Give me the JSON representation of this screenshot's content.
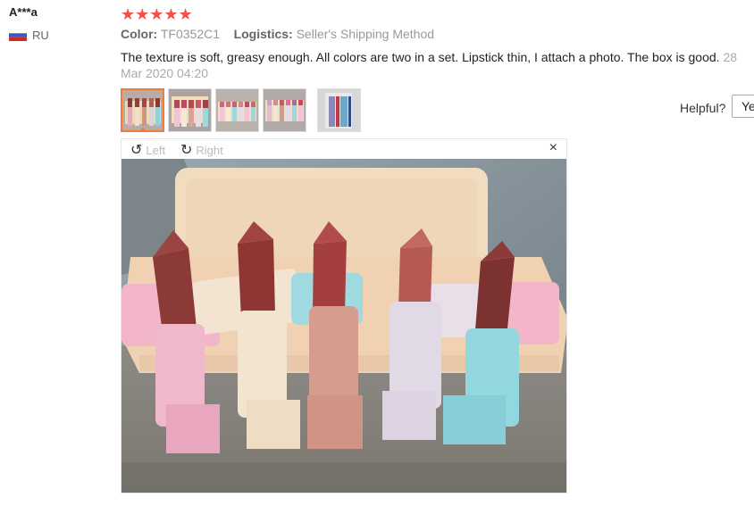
{
  "review": {
    "username": "A***a",
    "country": "RU",
    "stars": "★★★★★",
    "color_label": "Color:",
    "color_value": "TF0352C1",
    "logistics_label": "Logistics:",
    "logistics_value": "Seller's Shipping Method",
    "text": "The texture is soft, greasy enough. All colors are two in a set. Lipstick thin, I attach a photo. The box is good.",
    "date": "28 Mar 2020 04:20",
    "helpful_label": "Helpful?",
    "yes_label": "Ye"
  },
  "viewer": {
    "rotate_left": "Left",
    "rotate_right": "Right",
    "close": "×",
    "rotate_left_icon": "rotate-left-icon",
    "rotate_right_icon": "rotate-right-icon"
  },
  "thumbnails": [
    "thumb-1",
    "thumb-2",
    "thumb-3",
    "thumb-4",
    "thumb-5"
  ],
  "colors": {
    "stars": "#f05046",
    "active_thumb": "#f07a38"
  }
}
